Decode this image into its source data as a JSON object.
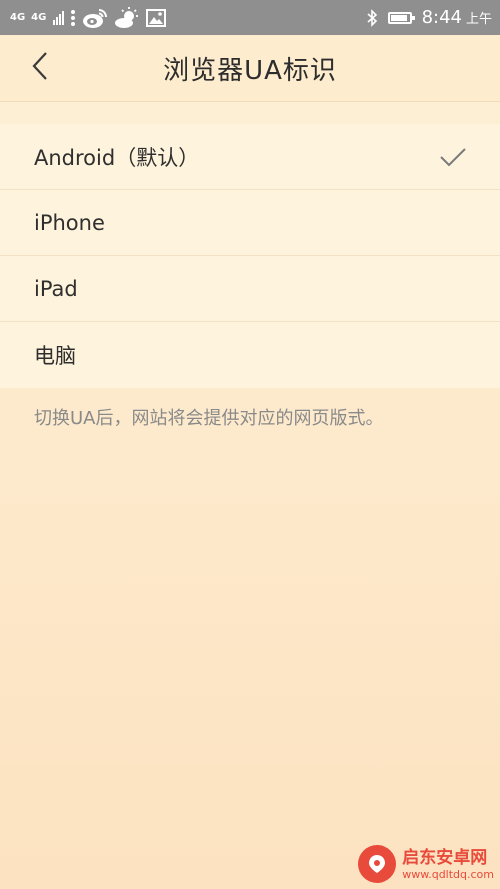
{
  "status_bar": {
    "net1": "4G",
    "net2": "4G",
    "time": "8:44",
    "ampm": "上午",
    "icons": [
      "signal-icon",
      "more-dots-icon",
      "weibo-icon",
      "weather-icon",
      "gallery-icon",
      "bluetooth-icon",
      "battery-icon"
    ]
  },
  "header": {
    "title": "浏览器UA标识",
    "back_icon": "chevron-left-icon"
  },
  "options": [
    {
      "label": "Android（默认）",
      "selected": true
    },
    {
      "label": "iPhone",
      "selected": false
    },
    {
      "label": "iPad",
      "selected": false
    },
    {
      "label": "电脑",
      "selected": false
    }
  ],
  "hint": "切换UA后，网站将会提供对应的网页版式。",
  "watermark": {
    "name": "启东安卓网",
    "url": "www.qdltdq.com"
  },
  "colors": {
    "status_bar": "#8f8f8f",
    "background": "#fde9cb",
    "list_background": "#fef3dc",
    "check": "#7a7a7a",
    "watermark": "#e84a3b"
  }
}
